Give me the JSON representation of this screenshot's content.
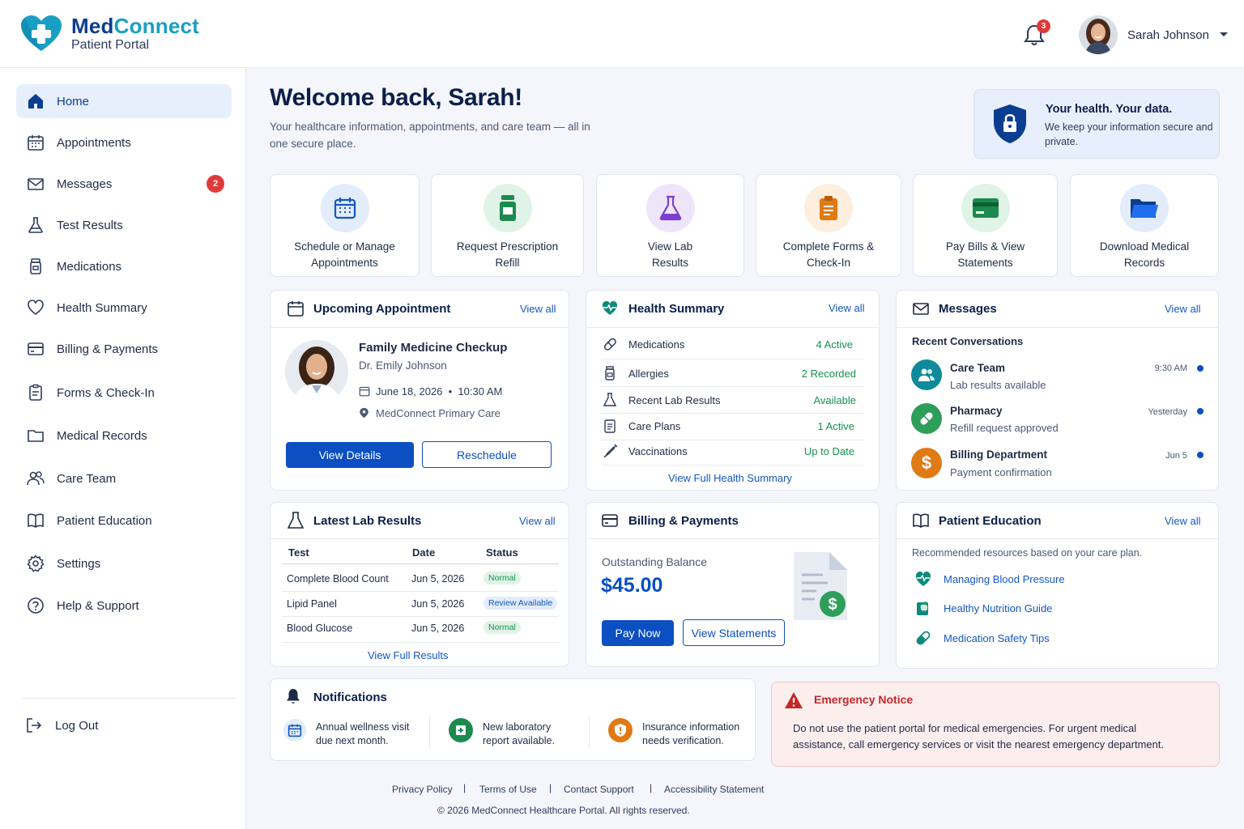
{
  "app": {
    "brand_a": "Med",
    "brand_b": "Connect",
    "subtitle": "Patient Portal"
  },
  "header": {
    "notifications_count": "3",
    "user_name": "Sarah Johnson"
  },
  "sidebar": {
    "items": [
      {
        "label": "Home",
        "icon": "home-icon"
      },
      {
        "label": "Appointments",
        "icon": "calendar-icon"
      },
      {
        "label": "Messages",
        "icon": "mail-icon",
        "badge": "2"
      },
      {
        "label": "Test Results",
        "icon": "flask-icon"
      },
      {
        "label": "Medications",
        "icon": "pill-bottle-icon"
      },
      {
        "label": "Health Summary",
        "icon": "heart-icon"
      },
      {
        "label": "Billing & Payments",
        "icon": "credit-card-icon"
      },
      {
        "label": "Forms & Check-In",
        "icon": "clipboard-icon"
      },
      {
        "label": "Medical Records",
        "icon": "folder-icon"
      },
      {
        "label": "Care Team",
        "icon": "users-icon"
      },
      {
        "label": "Patient Education",
        "icon": "book-icon"
      },
      {
        "label": "Settings",
        "icon": "gear-icon"
      },
      {
        "label": "Help & Support",
        "icon": "help-icon"
      }
    ],
    "logout": "Log Out"
  },
  "welcome": {
    "title": "Welcome back, Sarah!",
    "subtitle": "Your healthcare information, appointments, and care team — all in one secure place."
  },
  "secure_box": {
    "title": "Your health. Your data.",
    "text": "We keep your information secure and private."
  },
  "quick_actions": [
    {
      "line1": "Schedule or Manage",
      "line2": "Appointments",
      "color": "#1557c0"
    },
    {
      "line1": "Request Prescription",
      "line2": "Refill",
      "color": "#1c8a4f"
    },
    {
      "line1": "View Lab",
      "line2": "Results",
      "color": "#7b3fd0"
    },
    {
      "line1": "Complete Forms &",
      "line2": "Check-In",
      "color": "#e07a14"
    },
    {
      "line1": "Pay Bills & View",
      "line2": "Statements",
      "color": "#1c8a4f"
    },
    {
      "line1": "Download Medical",
      "line2": "Records",
      "color": "#1557c0"
    }
  ],
  "appointment": {
    "title": "Upcoming Appointment",
    "view_all": "View all",
    "name": "Family Medicine Checkup",
    "doctor": "Dr. Emily Johnson",
    "date": "June 18, 2026",
    "time": "10:30 AM",
    "location": "MedConnect Primary Care",
    "details_btn": "View Details",
    "reschedule_btn": "Reschedule"
  },
  "health_summary": {
    "title": "Health Summary",
    "view_all": "View all",
    "rows": [
      {
        "label": "Medications",
        "value": "4 Active"
      },
      {
        "label": "Allergies",
        "value": "2 Recorded"
      },
      {
        "label": "Recent Lab Results",
        "value": "Available"
      },
      {
        "label": "Care Plans",
        "value": "1 Active"
      },
      {
        "label": "Vaccinations",
        "value": "Up to Date"
      }
    ],
    "link": "View Full Health Summary"
  },
  "messages": {
    "title": "Messages",
    "view_all": "View all",
    "section": "Recent Conversations",
    "items": [
      {
        "from": "Care Team",
        "preview": "Lab results available",
        "time": "9:30 AM",
        "color": "#0e8a9a"
      },
      {
        "from": "Pharmacy",
        "preview": "Refill request approved",
        "time": "Yesterday",
        "color": "#2e9e5b"
      },
      {
        "from": "Billing Department",
        "preview": "Payment confirmation",
        "time": "Jun 5",
        "color": "#e07a14"
      }
    ]
  },
  "labs": {
    "title": "Latest Lab Results",
    "view_all": "View all",
    "headers": [
      "Test",
      "Date",
      "Status"
    ],
    "rows": [
      {
        "test": "Complete Blood Count",
        "date": "Jun 5, 2026",
        "status": "Normal"
      },
      {
        "test": "Lipid Panel",
        "date": "Jun 5, 2026",
        "status": "Review Available"
      },
      {
        "test": "Blood Glucose",
        "date": "Jun 5, 2026",
        "status": "Normal"
      }
    ],
    "link": "View Full Results"
  },
  "billing": {
    "title": "Billing & Payments",
    "balance_label": "Outstanding Balance",
    "balance": "$45.00",
    "pay_btn": "Pay Now",
    "statements_btn": "View Statements"
  },
  "education": {
    "title": "Patient Education",
    "view_all": "View all",
    "intro": "Recommended resources based on your care plan.",
    "items": [
      "Managing Blood Pressure",
      "Healthy Nutrition Guide",
      "Medication Safety Tips"
    ]
  },
  "notifications": {
    "title": "Notifications",
    "items": [
      {
        "line1": "Annual wellness visit",
        "line2": "due next month."
      },
      {
        "line1": "New laboratory",
        "line2": "report available."
      },
      {
        "line1": "Insurance information",
        "line2": "needs verification."
      }
    ]
  },
  "emergency": {
    "title": "Emergency Notice",
    "line1": "Do not use the patient portal for medical emergencies. For urgent medical",
    "line2": "assistance, call emergency services or visit the nearest emergency department."
  },
  "footer": {
    "links": [
      "Privacy Policy",
      "Terms of Use",
      "Contact Support",
      "Accessibility Statement"
    ],
    "copyright": "© 2026 MedConnect Healthcare Portal. All rights reserved."
  }
}
